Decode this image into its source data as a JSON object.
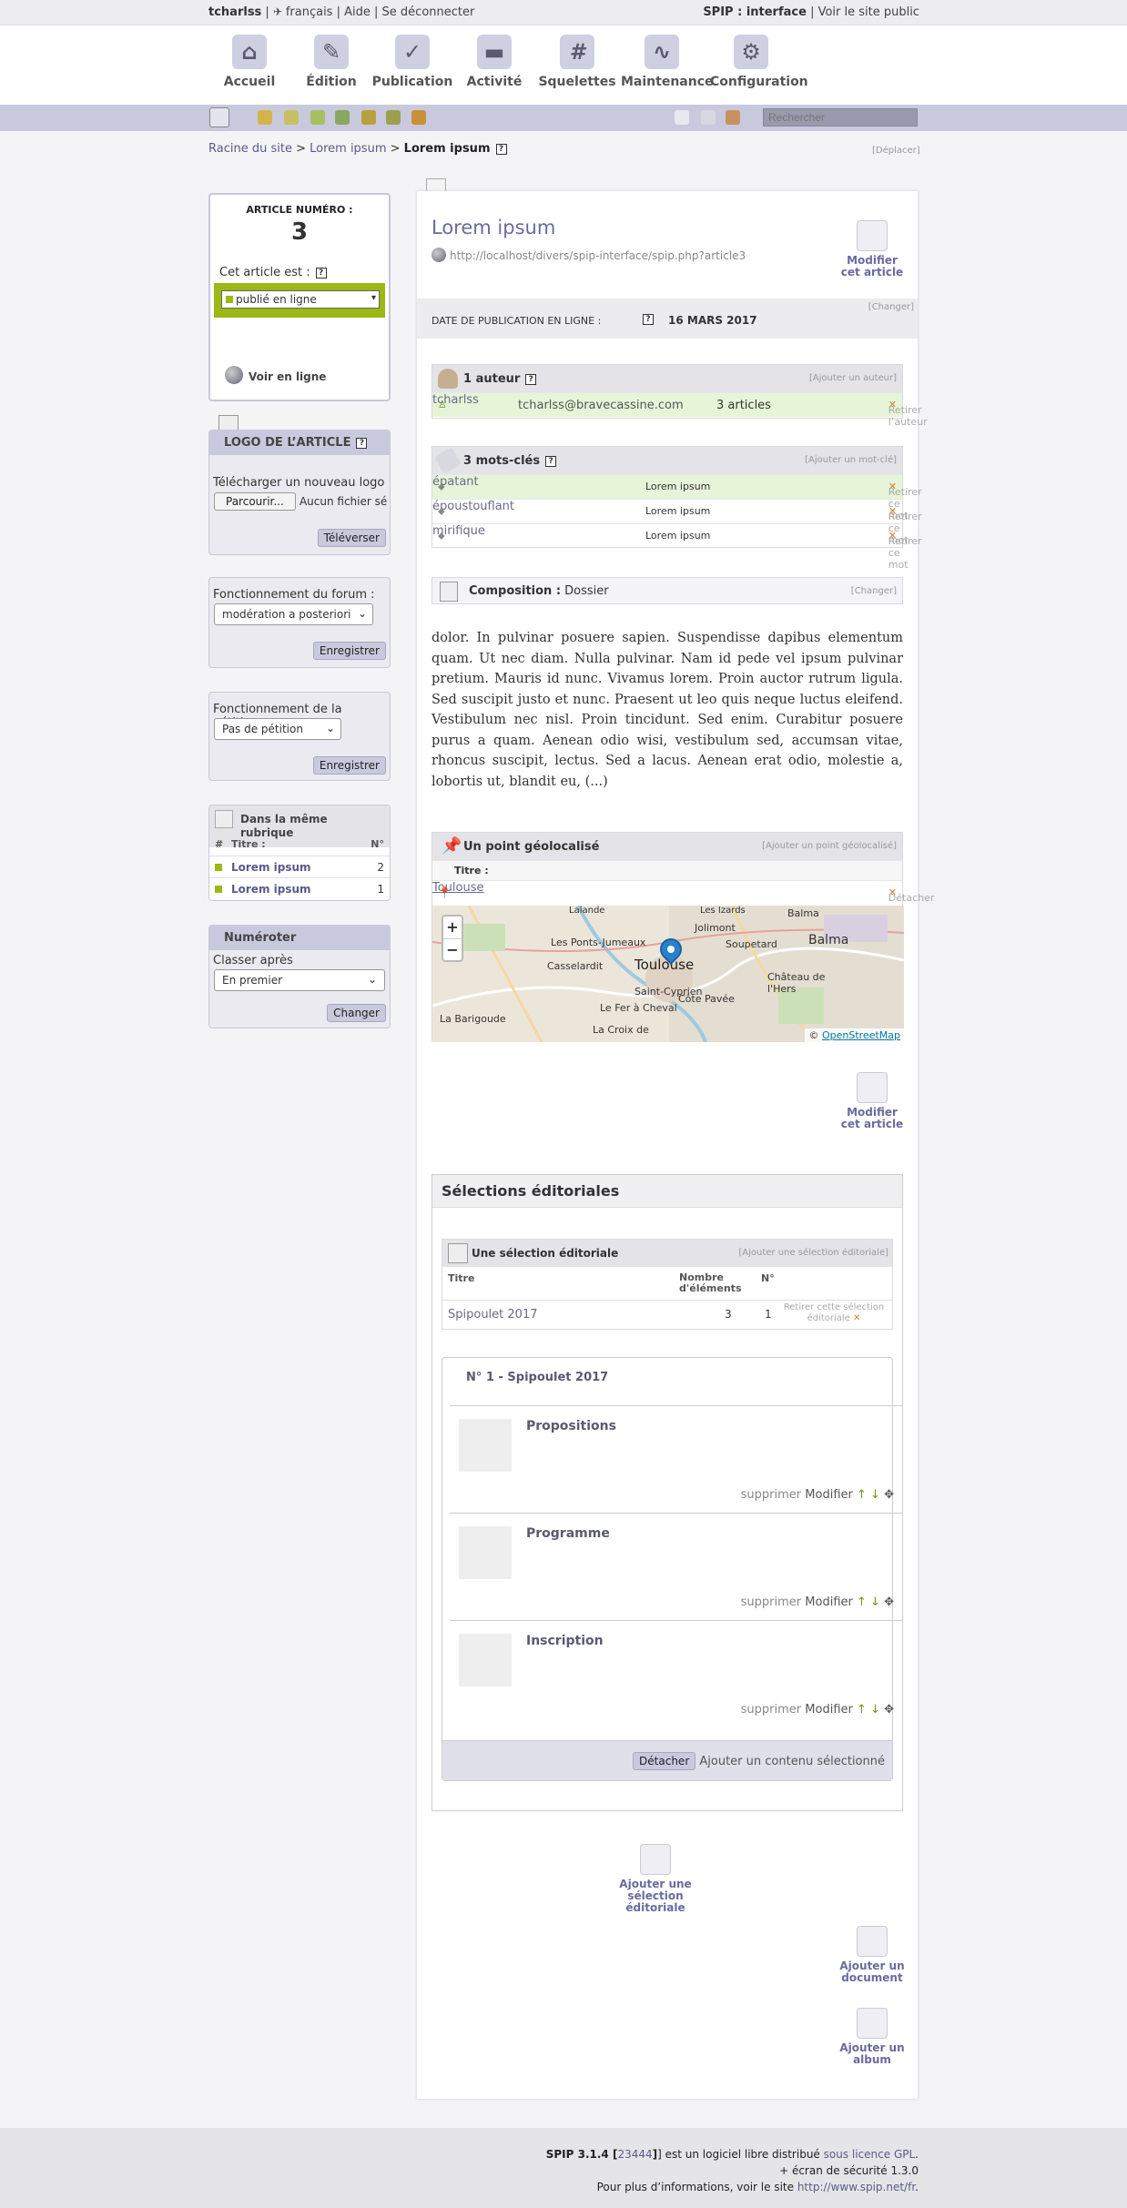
{
  "topbar": {
    "user": "tcharlss",
    "sep1": " | ",
    "lang": "français",
    "sep2": " | ",
    "help": "Aide",
    "sep3": " | ",
    "logout": "Se déconnecter",
    "interface_label": "SPIP : interface",
    "sep4": " | ",
    "public_site": "Voir le site public"
  },
  "nav": [
    {
      "label": "Accueil",
      "icon": "home-icon"
    },
    {
      "label": "Édition",
      "icon": "pencil-icon"
    },
    {
      "label": "Publication",
      "icon": "check-icon"
    },
    {
      "label": "Activité",
      "icon": "chat-icon"
    },
    {
      "label": "Squelettes",
      "icon": "hash-icon"
    },
    {
      "label": "Maintenance",
      "icon": "pulse-icon"
    },
    {
      "label": "Configuration",
      "icon": "gear-icon"
    }
  ],
  "search": {
    "placeholder": "Rechercher"
  },
  "breadcrumb": {
    "root": "Racine du site",
    "sep": " > ",
    "rubrique": "Lorem ipsum",
    "current": "Lorem ipsum",
    "move": "[Déplacer]"
  },
  "article_box": {
    "number_label": "ARTICLE NUMÉRO :",
    "number": "3",
    "status_label": "Cet article est :",
    "status": "publié en ligne",
    "view_online": "Voir en ligne"
  },
  "logo_box": {
    "title": "LOGO DE L’ARTICLE",
    "upload_label": "Télécharger un nouveau logo :",
    "browse": "Parcourir...",
    "no_file": "Aucun fichier sélectionné.",
    "submit": "Téléverser"
  },
  "forum_box": {
    "label": "Fonctionnement du forum :",
    "value": "modération a posteriori",
    "submit": "Enregistrer"
  },
  "petition_box": {
    "label": "Fonctionnement de la pétition :",
    "value": "Pas de pétition",
    "submit": "Enregistrer"
  },
  "same_rubric": {
    "title": "Dans la même rubrique",
    "col_hash": "#",
    "col_title": "Titre :",
    "col_num": "N°",
    "items": [
      {
        "title": "Lorem ipsum",
        "num": "2"
      },
      {
        "title": "Lorem ipsum",
        "num": "1"
      }
    ]
  },
  "numeroter": {
    "title": "Numéroter",
    "label": "Classer après",
    "value": "En premier",
    "submit": "Changer"
  },
  "article": {
    "title": "Lorem ipsum",
    "url": "http://localhost/divers/spip-interface/spip.php?article3",
    "edit": "Modifier cet article",
    "date_label": "DATE DE PUBLICATION EN LIGNE :",
    "date": "16 MARS 2017",
    "date_change": "[Changer]"
  },
  "authors": {
    "title": "1 auteur",
    "add": "[Ajouter un auteur]",
    "rows": [
      {
        "name": "tcharlss",
        "email": "tcharlss@bravecassine.com",
        "count": "3 articles",
        "remove": "Retirer l’auteur"
      }
    ]
  },
  "keywords": {
    "title": "3 mots-clés",
    "add": "[Ajouter un mot-clé]",
    "rows": [
      {
        "word": "épatant",
        "group": "Lorem ipsum",
        "remove": "Retirer ce mot"
      },
      {
        "word": "époustouflant",
        "group": "Lorem ipsum",
        "remove": "Retirer ce mot"
      },
      {
        "word": "mirifique",
        "group": "Lorem ipsum",
        "remove": "Retirer ce mot"
      }
    ]
  },
  "composition": {
    "label": "Composition :",
    "value": "Dossier",
    "change": "[Changer]"
  },
  "text": "dolor. In pulvinar posuere sapien. Suspendisse dapibus elementum quam. Ut nec diam. Nulla pulvinar. Nam id pede vel ipsum pulvinar pretium. Mauris id nunc. Vivamus lorem. Proin auctor rutrum ligula. Sed suscipit justo et nunc. Praesent ut leo quis neque luctus eleifend. Vestibulum nec nisl. Proin tincidunt. Sed enim. Curabitur posuere purus a quam. Aenean odio wisi, vestibulum sed, accumsan vitae, rhoncus suscipit, lectus. Sed a lacus. Aenean erat odio, molestie a, lobortis ut, blandit eu, (...)",
  "geo": {
    "title": "Un point géolocalisé",
    "add": "[Ajouter un point géolocalisé]",
    "col_title": "Titre :",
    "point": "Toulouse",
    "detach": "Détacher",
    "zoom_in": "+",
    "zoom_out": "−",
    "attribution_prefix": "©",
    "attribution_link": "OpenStreetMap",
    "labels": [
      "Lalande",
      "Les Izards",
      "Jolimont",
      "Balma",
      "Balma",
      "Les Ponts-Jumeaux",
      "Soupetard",
      "Casselardit",
      "Toulouse",
      "Château de l'Hers",
      "Saint-Cyprien",
      "Côte Pavée",
      "Le Fer à Cheval",
      "La Barigoude",
      "La Croix de"
    ]
  },
  "edit2": "Modifier cet article",
  "selections": {
    "title": "Sélections éditoriales",
    "sub_title": "Une sélection éditoriale",
    "add": "[Ajouter une sélection éditoriale]",
    "col_title": "Titre",
    "col_count": "Nombre d'éléments",
    "col_num": "N°",
    "row": {
      "title": "Spipoulet 2017",
      "count": "3",
      "num": "1",
      "remove": "Retirer cette sélection éditoriale"
    },
    "detail_title": "N° 1 - Spipoulet 2017",
    "items": [
      {
        "title": "Propositions"
      },
      {
        "title": "Programme"
      },
      {
        "title": "Inscription"
      }
    ],
    "delete": "supprimer",
    "modify": "Modifier",
    "detach": "Détacher",
    "add_content": "Ajouter un contenu sélectionné"
  },
  "bottom_actions": {
    "add_selection": "Ajouter une sélection éditoriale",
    "add_document": "Ajouter un document",
    "add_album": "Ajouter un album"
  },
  "footer": {
    "line1_a": "SPIP 3.1.4 [",
    "line1_rev": "23444",
    "line1_b": "] est un logiciel libre distribué ",
    "line1_link": "sous licence GPL",
    "line1_c": ".",
    "line2": "+ écran de sécurité 1.3.0",
    "line3_a": "Pour plus d’informations, voir le site ",
    "line3_link": "http://www.spip.net/fr",
    "line3_b": "."
  }
}
